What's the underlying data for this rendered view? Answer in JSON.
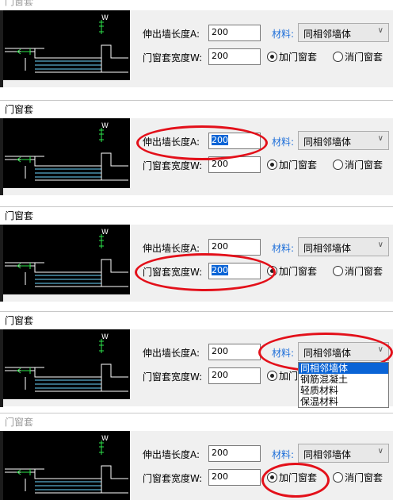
{
  "dialog": {
    "title": "门窗套",
    "ext_label": "伸出墙长度A:",
    "ext_value": "200",
    "width_label": "门窗套宽度W:",
    "width_value": "200",
    "material_label": "材料:",
    "material_value": "同相邻墙体",
    "material_options": [
      "同相邻墙体",
      "钢筋混凝土",
      "轻质材料",
      "保温材料"
    ],
    "radio_add": "加门窗套",
    "radio_remove": "消门窗套",
    "preview_label_w": "W"
  },
  "colors": {
    "highlight_red": "#e3101a",
    "selection_blue": "#0a64d6",
    "label_blue": "#1e6fd9"
  }
}
